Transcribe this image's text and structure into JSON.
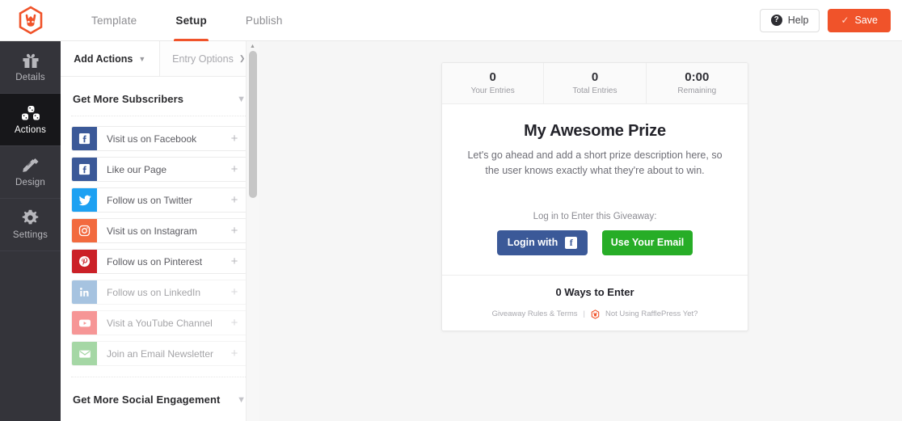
{
  "header": {
    "logo_icon": "rafflepress-bunny-logo",
    "tabs": [
      {
        "label": "Template",
        "active": false
      },
      {
        "label": "Setup",
        "active": true
      },
      {
        "label": "Publish",
        "active": false
      }
    ],
    "help_label": "Help",
    "help_icon": "question-circle-icon",
    "save_label": "Save",
    "save_icon": "check-icon",
    "accent_color": "#f0532a"
  },
  "rail": {
    "items": [
      {
        "label": "Details",
        "icon": "gift-icon",
        "active": false
      },
      {
        "label": "Actions",
        "icon": "blocks-icon",
        "active": true
      },
      {
        "label": "Design",
        "icon": "pencil-ruler-icon",
        "active": false
      },
      {
        "label": "Settings",
        "icon": "gear-icon",
        "active": false
      }
    ]
  },
  "panel": {
    "tabs": [
      {
        "label": "Add Actions",
        "icon": "chevron-down-icon",
        "active": true
      },
      {
        "label": "Entry Options",
        "icon": "chevron-right-icon",
        "active": false
      }
    ],
    "sections": [
      {
        "title": "Get More Subscribers",
        "collapse_icon": "chevron-down-icon"
      },
      {
        "title": "Get More Social Engagement",
        "collapse_icon": "chevron-down-icon"
      }
    ],
    "actions": [
      {
        "label": "Visit us on Facebook",
        "icon": "facebook-icon",
        "color": "#3b5998",
        "add_icon": "plus-icon",
        "dim": false
      },
      {
        "label": "Like our Page",
        "icon": "facebook-icon",
        "color": "#3b5998",
        "add_icon": "plus-icon",
        "dim": false
      },
      {
        "label": "Follow us on Twitter",
        "icon": "twitter-icon",
        "color": "#1da1f2",
        "add_icon": "plus-icon",
        "dim": false
      },
      {
        "label": "Visit us on Instagram",
        "icon": "instagram-icon",
        "color": "#f26a3e",
        "add_icon": "plus-icon",
        "dim": false
      },
      {
        "label": "Follow us on Pinterest",
        "icon": "pinterest-icon",
        "color": "#cb2027",
        "add_icon": "plus-icon",
        "dim": false
      },
      {
        "label": "Follow us on LinkedIn",
        "icon": "linkedin-icon",
        "color": "#5f93c7",
        "add_icon": "plus-icon",
        "dim": true
      },
      {
        "label": "Visit a YouTube Channel",
        "icon": "youtube-icon",
        "color": "#f04141",
        "add_icon": "plus-icon",
        "dim": true
      },
      {
        "label": "Join an Email Newsletter",
        "icon": "envelope-icon",
        "color": "#5cb85c",
        "add_icon": "plus-icon",
        "dim": true
      }
    ],
    "scrollbar": {
      "arrow_icon": "caret-up-icon"
    }
  },
  "preview": {
    "stats": [
      {
        "value": "0",
        "label": "Your Entries"
      },
      {
        "value": "0",
        "label": "Total Entries"
      },
      {
        "value": "0:00",
        "label": "Remaining"
      }
    ],
    "prize_title": "My Awesome Prize",
    "prize_description": "Let's go ahead and add a short prize description here, so the user knows exactly what they're about to win.",
    "login_prompt": "Log in to Enter this Giveaway:",
    "facebook_button": {
      "label": "Login with",
      "icon": "facebook-icon",
      "color": "#3b5998"
    },
    "email_button": {
      "label": "Use Your Email",
      "color": "#27ad27"
    },
    "ways_to_enter": "0 Ways to Enter",
    "footer": {
      "rules_link": "Giveaway Rules & Terms",
      "separator": "|",
      "badge_icon": "rafflepress-bunny-logo",
      "promo_link": "Not Using RafflePress Yet?"
    }
  }
}
